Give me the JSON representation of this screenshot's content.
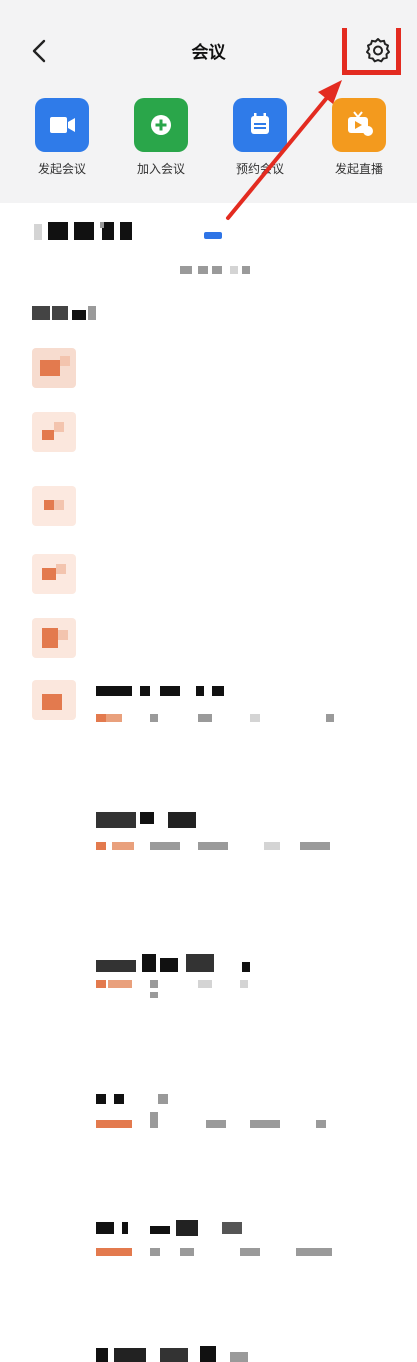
{
  "header": {
    "title": "会议"
  },
  "actions": [
    {
      "label": "发起会议",
      "icon": "video-camera-icon",
      "color": "#2f7be9"
    },
    {
      "label": "加入会议",
      "icon": "plus-circle-icon",
      "color": "#2aa64a"
    },
    {
      "label": "预约会议",
      "icon": "calendar-icon",
      "color": "#2f7be9"
    },
    {
      "label": "发起直播",
      "icon": "live-tv-icon",
      "color": "#f39a1e"
    }
  ],
  "colors": {
    "annotation": "#e32b20",
    "accent_blue": "#2e74e6",
    "header_bg": "#f3f3f4"
  }
}
